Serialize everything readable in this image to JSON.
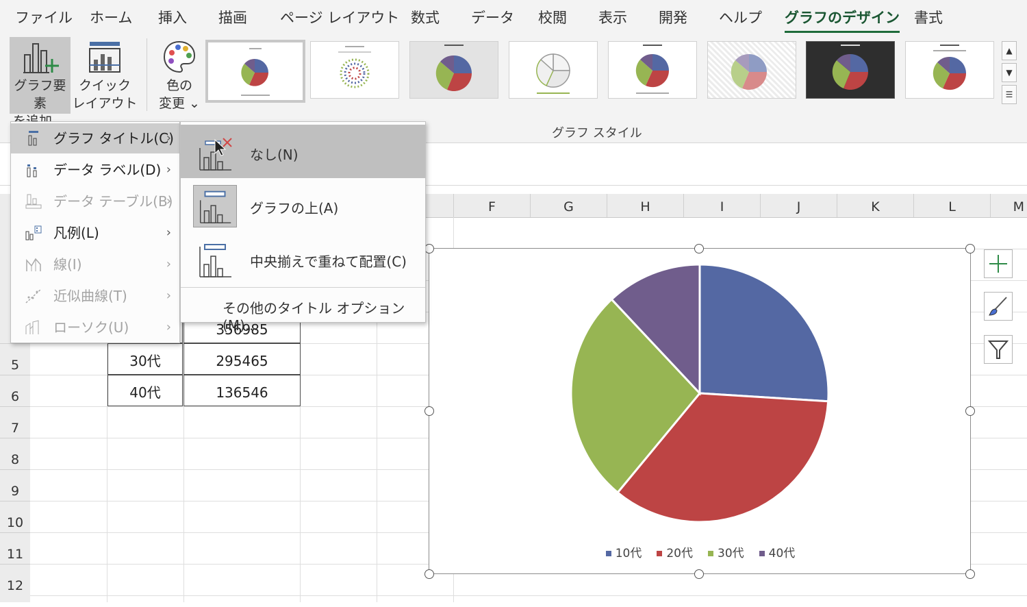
{
  "tabs": [
    "ファイル",
    "ホーム",
    "挿入",
    "描画",
    "ページ レイアウト",
    "数式",
    "データ",
    "校閲",
    "表示",
    "開発",
    "ヘルプ",
    "グラフのデザイン",
    "書式"
  ],
  "ribbon": {
    "add_element": {
      "line1": "グラフ要素",
      "line2": "を追加 ⌄"
    },
    "quick_layout": {
      "line1": "クイック",
      "line2": "レイアウト ⌄"
    },
    "change_color": {
      "line1": "色の",
      "line2": "変更 ⌄"
    },
    "style_group_label": "グラフ スタイル"
  },
  "menu": {
    "items": [
      {
        "label": "グラフ タイトル(C)",
        "state": "active"
      },
      {
        "label": "データ ラベル(D)",
        "state": "normal"
      },
      {
        "label": "データ テーブル(B)",
        "state": "disabled"
      },
      {
        "label": "凡例(L)",
        "state": "normal"
      },
      {
        "label": "線(I)",
        "state": "disabled"
      },
      {
        "label": "近似曲線(T)",
        "state": "disabled"
      },
      {
        "label": "ローソク(U)",
        "state": "disabled"
      }
    ],
    "submenu": {
      "none": "なし(N)",
      "above": "グラフの上(A)",
      "overlay": "中央揃えで重ねて配置(C)",
      "more": "その他のタイトル オプション(M)..."
    }
  },
  "columns": [
    "F",
    "G",
    "H",
    "I",
    "J",
    "K",
    "L",
    "M"
  ],
  "rows": [
    "5",
    "6",
    "7",
    "8",
    "9",
    "10",
    "11",
    "12"
  ],
  "table": [
    {
      "label": "",
      "value": "356985"
    },
    {
      "label": "30代",
      "value": "295465"
    },
    {
      "label": "40代",
      "value": "136546"
    }
  ],
  "chart_data": {
    "type": "pie",
    "categories": [
      "10代",
      "20代",
      "30代",
      "40代"
    ],
    "values": [
      0.26,
      0.35,
      0.27,
      0.12
    ],
    "colors": [
      "#5468a3",
      "#bd4444",
      "#97b553",
      "#705d8c"
    ],
    "legend_position": "bottom"
  },
  "chevron": "›"
}
